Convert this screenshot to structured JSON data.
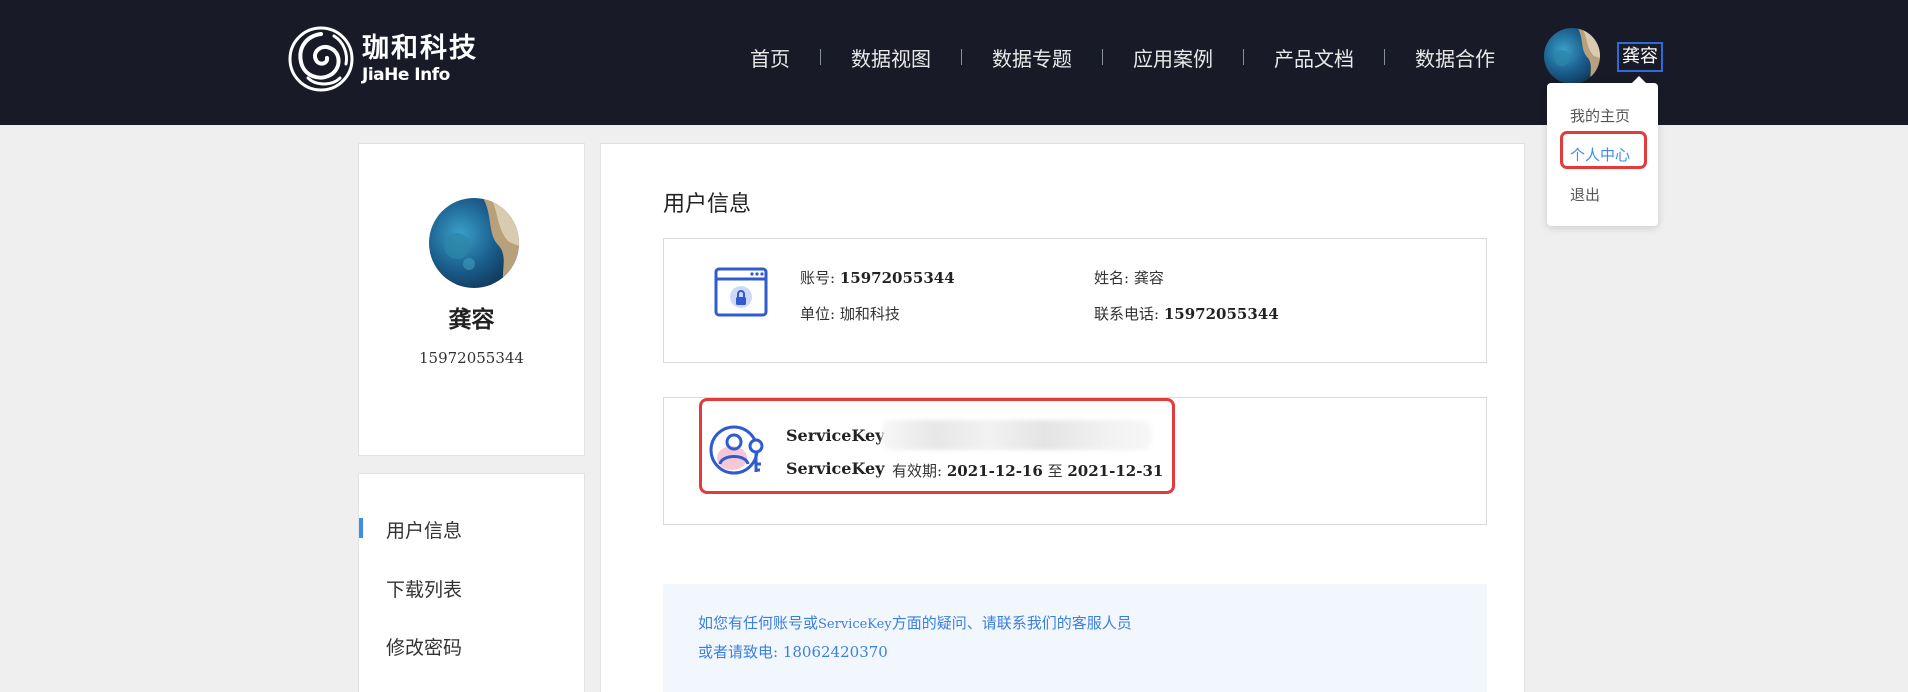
{
  "brand": {
    "name_cn": "珈和科技",
    "name_en": "JiaHe Info"
  },
  "nav": {
    "items": [
      "首页",
      "数据视图",
      "数据专题",
      "应用案例",
      "产品文档",
      "数据合作"
    ]
  },
  "header": {
    "user_name": "龚容"
  },
  "dropdown": {
    "items": [
      "我的主页",
      "个人中心",
      "退出"
    ],
    "active": "个人中心"
  },
  "profile": {
    "name": "龚容",
    "phone": "15972055344"
  },
  "menu": {
    "items": [
      "用户信息",
      "下载列表",
      "修改密码"
    ],
    "active": "用户信息"
  },
  "user_info": {
    "title": "用户信息",
    "account_label": "账号:",
    "account_value": "15972055344",
    "name_label": "姓名:",
    "name_value": "龚容",
    "org_label": "单位:",
    "org_value": "珈和科技",
    "tel_label": "联系电话:",
    "tel_value": "15972055344"
  },
  "service_key": {
    "label": "ServiceKey",
    "label2": "ServiceKey",
    "valid_label": "有效期:",
    "valid_from": "2021-12-16",
    "valid_sep": "至",
    "valid_to": "2021-12-31"
  },
  "notice": {
    "line1_a": "如您有任何账号或",
    "line1_key": "ServiceKey",
    "line1_b": "方面的疑问、请联系我们的客服人员",
    "line2_label": "或者请致电:",
    "line2_phone": "18062420370"
  },
  "colors": {
    "header_bg": "#181b27",
    "accent": "#3b8ef0",
    "highlight": "#e23b3b"
  }
}
